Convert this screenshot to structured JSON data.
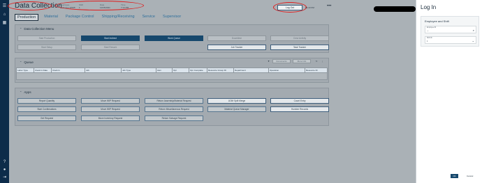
{
  "app": {
    "title": "Data Collection"
  },
  "header": {
    "info": [
      {
        "label": "Employee",
        "value": "Unknown 12345"
      },
      {
        "label": "Shift",
        "value": "1"
      },
      {
        "label": "Date",
        "value": "11/15/2021"
      },
      {
        "label": "Time",
        "value": "7:14 PM"
      }
    ],
    "logout_label": "Log Out",
    "datetime": "09:43 PM",
    "more": "•••"
  },
  "tabs": [
    "Production",
    "Material",
    "Package Control",
    "Shipping/Receiving",
    "Service",
    "Supervisor"
  ],
  "menu": {
    "title": "Data Collection Menu",
    "buttons": [
      "Start Production",
      "Start Indirect",
      "Work Queue",
      "Downtime",
      "Crew Activity",
      "Start Setup",
      "Start Rework",
      "Job Tracker",
      "Task Tracker"
    ]
  },
  "queue": {
    "title": "Queue",
    "documents_label": "Documents",
    "more_info_label": "More Info",
    "columns": [
      "Labor Type",
      "Clock In Date",
      "Clock In",
      "Job",
      "Job Type",
      "Asm",
      "Opr",
      "Opr Complete",
      "Resource Group ID",
      "Department",
      "Operation",
      "Resource ID"
    ]
  },
  "apps": {
    "title": "Apps",
    "buttons": [
      "Report Quantity",
      "Move WIP Request",
      "Return Assembly/Material Request",
      "UOM Split Merge",
      "Count Entry",
      "Start Confirmations",
      "Move WIP Request",
      "Return Miscellaneous Request",
      "Material Queue Manager",
      "Humber Records",
      "Get Request",
      "Move Inventory Request",
      "Return Salvage Request"
    ]
  },
  "login_panel": {
    "title": "Log In",
    "card_title": "Employee and Shift",
    "employee_label": "Employee ID",
    "employee_value": "—",
    "shift_label": "Shift ID",
    "shift_value": "1",
    "ok_label": "OK",
    "cancel_label": "Cancel"
  },
  "rail_icons": [
    "menu-icon",
    "home-icon",
    "grid-icon",
    "help-icon",
    "user-icon",
    "logout-icon"
  ]
}
